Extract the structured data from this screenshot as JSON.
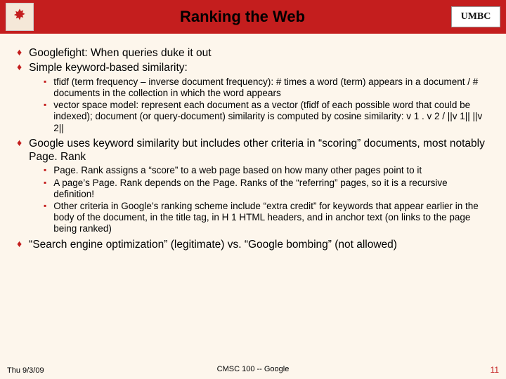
{
  "header": {
    "title": "Ranking the Web",
    "logo_right_text": "UMBC"
  },
  "bullets": {
    "b1": "Googlefight: When queries duke it out",
    "b2": "Simple keyword-based similarity:",
    "b2a": "tfidf (term frequency – inverse document frequency): # times a word (term) appears in a document / # documents in the collection in which the word appears",
    "b2b": "vector space model: represent each document as a vector (tfidf of each possible word that could be indexed); document (or query-document) similarity is computed by cosine similarity: v 1 . v 2 / ||v 1|| ||v 2||",
    "b3": "Google uses keyword similarity but includes other criteria in “scoring” documents, most notably Page. Rank",
    "b3a": "Page. Rank assigns a “score” to a web page based on how many other pages point to it",
    "b3b": "A page’s Page. Rank depends on the Page. Ranks of the “referring” pages, so it is a recursive definition!",
    "b3c": "Other criteria in Google’s ranking scheme include “extra credit” for keywords that appear earlier in the body of the document, in the title tag, in H 1 HTML headers, and in anchor text (on links to the page being ranked)",
    "b4": "“Search engine optimization” (legitimate) vs. “Google bombing” (not allowed)"
  },
  "footer": {
    "date": "Thu 9/3/09",
    "course": "CMSC 100 -- Google",
    "page": "11"
  }
}
